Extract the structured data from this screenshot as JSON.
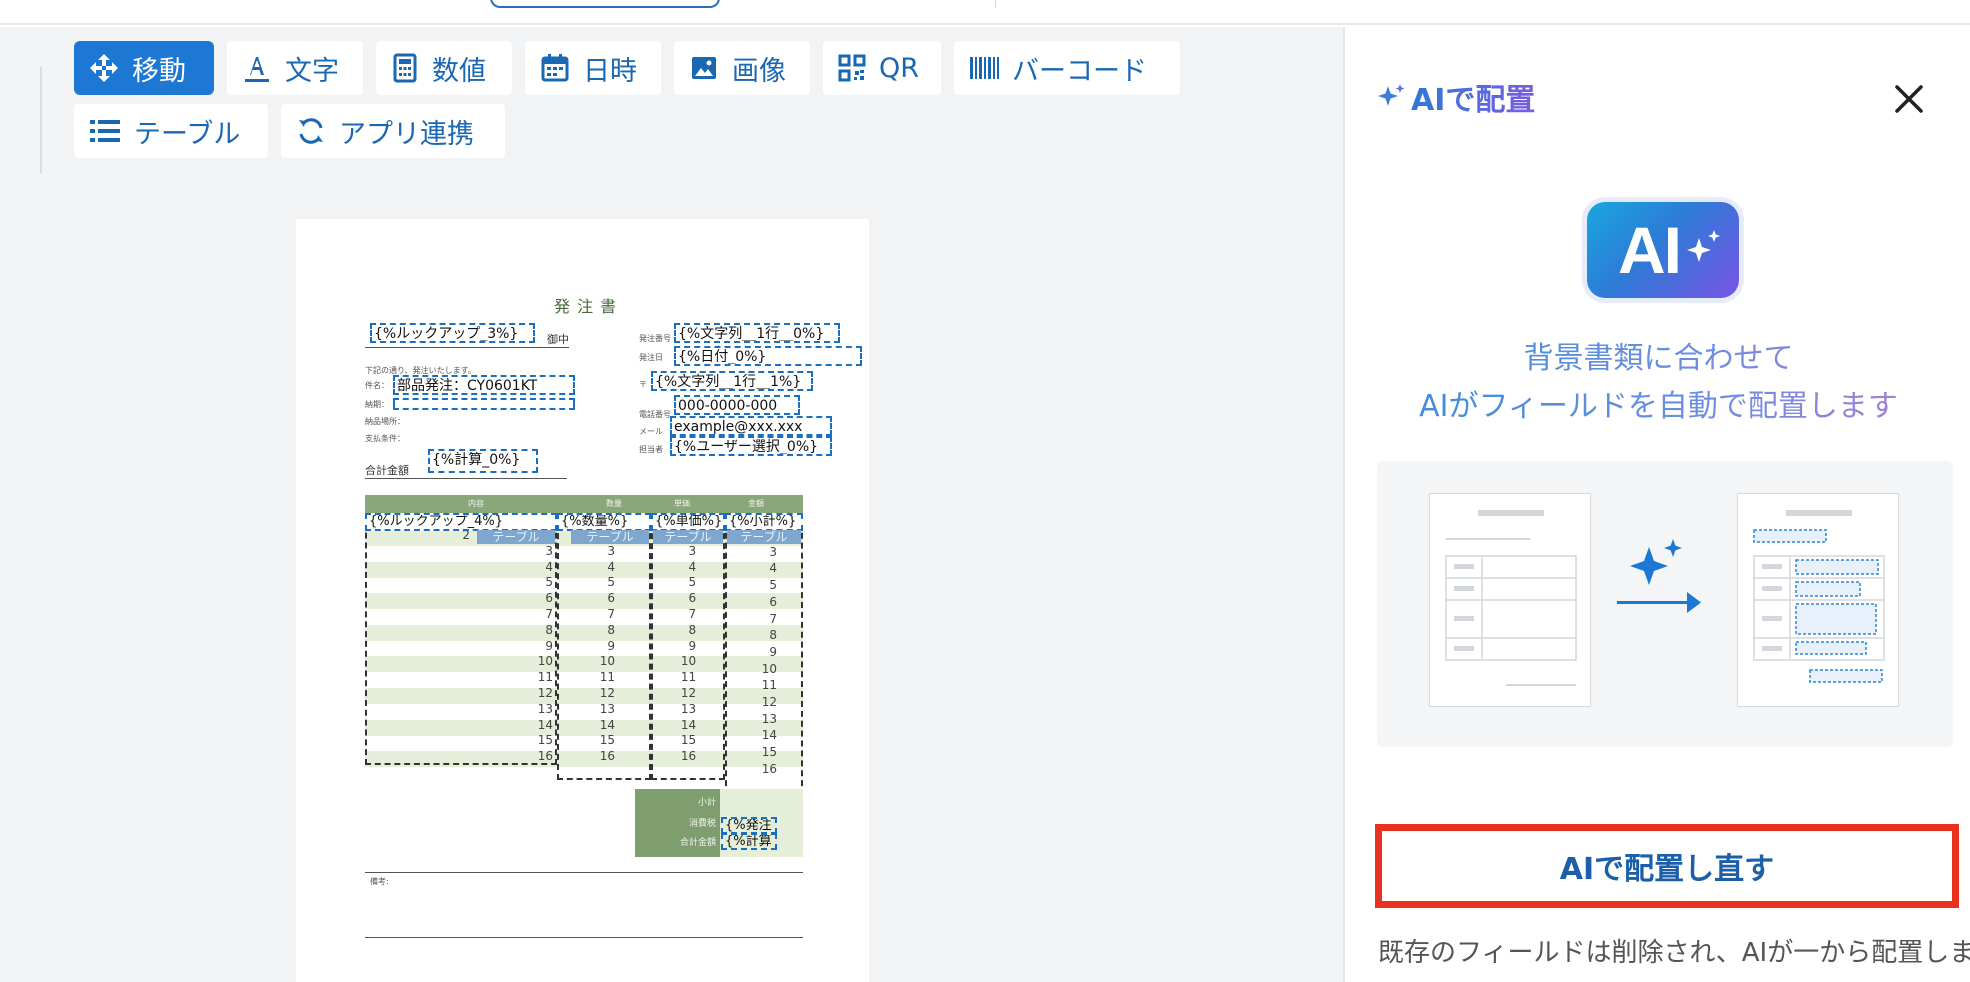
{
  "toolbar": {
    "items": [
      {
        "label": "移動",
        "icon": "move-icon",
        "active": true
      },
      {
        "label": "文字",
        "icon": "text-icon"
      },
      {
        "label": "数値",
        "icon": "calculator-icon"
      },
      {
        "label": "日時",
        "icon": "calendar-icon"
      },
      {
        "label": "画像",
        "icon": "image-icon"
      },
      {
        "label": "QR",
        "icon": "qr-icon"
      },
      {
        "label": "バーコード",
        "icon": "barcode-icon"
      },
      {
        "label": "テーブル",
        "icon": "list-icon"
      },
      {
        "label": "アプリ連携",
        "icon": "sync-icon"
      }
    ]
  },
  "document": {
    "title": "発 注 書",
    "recipient_field": "{%ルックアップ_3%}",
    "honorific": "御中",
    "order_no_label": "発注番号",
    "order_no_field": "{%文字列__1行__0%}",
    "order_date_label": "発注日",
    "order_date_field": "{%日付_0%}",
    "intro_text": "下記の通り、発注いたします。",
    "subject_label": "件名：",
    "subject_field": "部品発注：CY0601KT",
    "deadline_label": "納期：",
    "delivery_place_label": "納品場所：",
    "payment_label": "支払条件：",
    "postal_label": "〒",
    "postal_field": "{%文字列__1行__1%}",
    "phone_label": "電話番号",
    "phone_field": "000-0000-000",
    "email_label": "メール",
    "email_field": "example@xxx.xxx",
    "staff_label": "担当者",
    "staff_field": "{%ユーザー選択_0%}",
    "total_label": "合計金額",
    "total_field": "{%計算_0%}",
    "table_headers": [
      "内容",
      "数量",
      "単価",
      "金額"
    ],
    "table_fields": [
      "{%ルックアップ_4%}",
      "{%数量%}",
      "{%単価%}",
      "{%小計%}"
    ],
    "table_chip": "テーブル",
    "row_numbers": [
      "2",
      "3",
      "4",
      "5",
      "6",
      "7",
      "8",
      "9",
      "10",
      "11",
      "12",
      "13",
      "14",
      "15",
      "16"
    ],
    "subtotal_label": "小計",
    "tax_label": "消費税",
    "grand_total_label": "合計金額",
    "tax_field": "{%発注",
    "grand_total_field": "{%計算",
    "notes_label": "備考:"
  },
  "panel": {
    "title": "AIで配置",
    "badge_text": "AI",
    "desc_line1": "背景書類に合わせて",
    "desc_line2": "AIがフィールドを自動で配置します",
    "redo_button": "AIで配置し直す",
    "note": "既存のフィールドは削除され、AIが一から配置します。"
  },
  "colors": {
    "accent": "#1c78d3",
    "highlight_border": "#e8321f",
    "table_green": "#8aa67b"
  }
}
